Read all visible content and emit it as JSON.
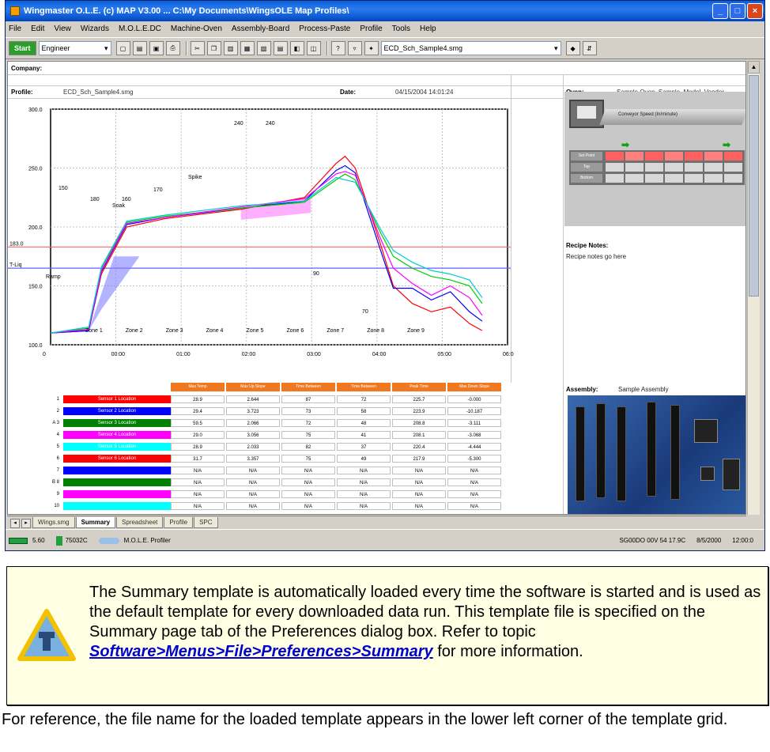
{
  "window": {
    "title": "Wingmaster O.L.E. (c) MAP V3.00 ... C:\\My Documents\\WingsOLE Map Profiles\\",
    "buttons": [
      "_",
      "□",
      "×"
    ]
  },
  "menubar": [
    "File",
    "Edit",
    "View",
    "Wizards",
    "M.O.L.E.DC",
    "Machine-Oven",
    "Assembly-Board",
    "Process-Paste",
    "Profile",
    "Tools",
    "Help"
  ],
  "toolbar": {
    "start_label": "Start",
    "user_level": "Engineer",
    "profile_file": "ECD_Sch_Sample4.smg"
  },
  "header": {
    "company_label": "Company:",
    "profile_label": "Profile:",
    "profile_value": "ECD_Sch_Sample4.smg",
    "date_label": "Date:",
    "date_value": "04/15/2004 14:01:24",
    "oven_label": "Oven:",
    "oven_value": "Sample Oven_Sample_Model_Vendor"
  },
  "chart_data": {
    "type": "line",
    "title": "",
    "xlabel": "",
    "ylabel": "",
    "x_ticks": [
      "0",
      "00:00",
      "01:00",
      "02:00",
      "03:00",
      "04:00",
      "05:00",
      "06:00"
    ],
    "y_ticks": [
      "100.0",
      "150.0",
      "200.0",
      "250.0",
      "300.0"
    ],
    "ylim": [
      100,
      300
    ],
    "xlim": [
      0,
      360
    ],
    "reference_lines": [
      {
        "label": "183.0",
        "value": 183,
        "color": "#ff6060"
      },
      {
        "label": "T-Liq",
        "value": 165,
        "color": "#6060ff"
      }
    ],
    "annotations": [
      "240",
      "240",
      "150",
      "180",
      "160",
      "Soak",
      "170",
      "Ramp",
      "Spike",
      "90",
      "70"
    ],
    "zones": [
      "Zone 1",
      "Zone 2",
      "Zone 3",
      "Zone 4",
      "Zone 5",
      "Zone 6",
      "Zone 7",
      "Zone 8",
      "Zone 9"
    ],
    "series": [
      {
        "color": "#ff0000",
        "x": [
          0,
          30,
          40,
          60,
          90,
          150,
          200,
          225,
          232,
          240,
          260,
          270,
          285,
          300,
          315,
          330,
          340
        ],
        "y": [
          110,
          112,
          160,
          200,
          207,
          215,
          225,
          254,
          260,
          250,
          185,
          150,
          135,
          128,
          132,
          118,
          112
        ]
      },
      {
        "color": "#0000ff",
        "x": [
          0,
          30,
          40,
          60,
          90,
          150,
          200,
          225,
          232,
          240,
          260,
          270,
          285,
          300,
          315,
          330,
          340
        ],
        "y": [
          110,
          112,
          162,
          202,
          208,
          216,
          222,
          248,
          252,
          246,
          180,
          148,
          148,
          138,
          145,
          128,
          120
        ]
      },
      {
        "color": "#00cc00",
        "x": [
          0,
          30,
          40,
          60,
          90,
          150,
          200,
          225,
          232,
          240,
          260,
          270,
          285,
          300,
          315,
          330,
          340
        ],
        "y": [
          110,
          114,
          165,
          204,
          209,
          216,
          221,
          240,
          245,
          240,
          195,
          175,
          165,
          158,
          155,
          150,
          135
        ]
      },
      {
        "color": "#ff00ff",
        "x": [
          0,
          30,
          40,
          60,
          90,
          150,
          200,
          225,
          232,
          240,
          260,
          270,
          285,
          300,
          315,
          330,
          340
        ],
        "y": [
          110,
          113,
          163,
          203,
          208,
          217,
          224,
          245,
          247,
          244,
          190,
          165,
          152,
          142,
          150,
          140,
          125
        ]
      },
      {
        "color": "#00cccc",
        "x": [
          0,
          30,
          40,
          60,
          90,
          150,
          200,
          225,
          232,
          240,
          260,
          270,
          285,
          300,
          315,
          330,
          340
        ],
        "y": [
          110,
          115,
          166,
          205,
          210,
          218,
          222,
          242,
          240,
          238,
          198,
          180,
          170,
          163,
          160,
          155,
          140
        ]
      }
    ]
  },
  "oven_panel": {
    "belt_label": "Conveyor Speed (In/minute)",
    "zone_rows": [
      "Set Point",
      "Top",
      "Bottom"
    ]
  },
  "recipe": {
    "label": "Recipe Notes:",
    "text": "Recipe notes go here"
  },
  "assembly": {
    "label": "Assembly:",
    "name": "Sample Assembly"
  },
  "sensor_table": {
    "headers": [
      "Max Temp",
      "Max Up Slope",
      "Time Between",
      "Time Between",
      "Peak Time",
      "Max Down Slope"
    ],
    "rows": [
      {
        "num": "1",
        "name": "Sensor 1 Location",
        "color": "#ff0000",
        "values": [
          "28.9",
          "2.644",
          "87",
          "72",
          "225.7",
          "-0.000"
        ]
      },
      {
        "num": "2",
        "name": "Sensor 2 Location",
        "color": "#0000ff",
        "values": [
          "29.4",
          "3.723",
          "73",
          "58",
          "223.9",
          "-10.187"
        ]
      },
      {
        "num": "A 3",
        "name": "Sensor 3 Location",
        "color": "#008000",
        "values": [
          "59.5",
          "2.066",
          "72",
          "48",
          "208.8",
          "-3.111"
        ]
      },
      {
        "num": "4",
        "name": "Sensor 4 Location",
        "color": "#ff00ff",
        "values": [
          "29.0",
          "3.056",
          "75",
          "41",
          "208.1",
          "-3.068"
        ]
      },
      {
        "num": "5",
        "name": "Sensor 5 Location",
        "color": "#00ffff",
        "values": [
          "28.9",
          "2.033",
          "82",
          "37",
          "220.4",
          "-4.444"
        ]
      },
      {
        "num": "6",
        "name": "Sensor 6 Location",
        "color": "#ff0000",
        "values": [
          "31.7",
          "3.357",
          "75",
          "49",
          "217.9",
          "-5.300"
        ]
      },
      {
        "num": "7",
        "name": "",
        "color": "#0000ff",
        "values": [
          "N/A",
          "N/A",
          "N/A",
          "N/A",
          "N/A",
          "N/A"
        ]
      },
      {
        "num": "B 8",
        "name": "",
        "color": "#008000",
        "values": [
          "N/A",
          "N/A",
          "N/A",
          "N/A",
          "N/A",
          "N/A"
        ]
      },
      {
        "num": "9",
        "name": "",
        "color": "#ff00ff",
        "values": [
          "N/A",
          "N/A",
          "N/A",
          "N/A",
          "N/A",
          "N/A"
        ]
      },
      {
        "num": "10",
        "name": "",
        "color": "#00ffff",
        "values": [
          "N/A",
          "N/A",
          "N/A",
          "N/A",
          "N/A",
          "N/A"
        ]
      }
    ]
  },
  "tabs": [
    "Wings.smg",
    "Summary",
    "Spreadsheet",
    "Profile",
    "SPC"
  ],
  "statusbar": {
    "left1": "5.60",
    "left2": "75032C",
    "left3": "M.O.L.E. Profiler",
    "right1": "SG00DO 00V 54   17.9C",
    "right2": "8/5/2000",
    "right3": "12:00:0"
  },
  "note": {
    "text_before": "The Summary template is automatically loaded every time the software is started and is used as the default template for every downloaded data run. This template file is specified on the Summary page tab of the Preferences dialog box. Refer to topic ",
    "link_text": "Software>Menus>File>Preferences>Summary",
    "text_after": " for more information."
  },
  "footer": "For reference, the file name for the loaded template appears in the lower left corner of the template grid."
}
